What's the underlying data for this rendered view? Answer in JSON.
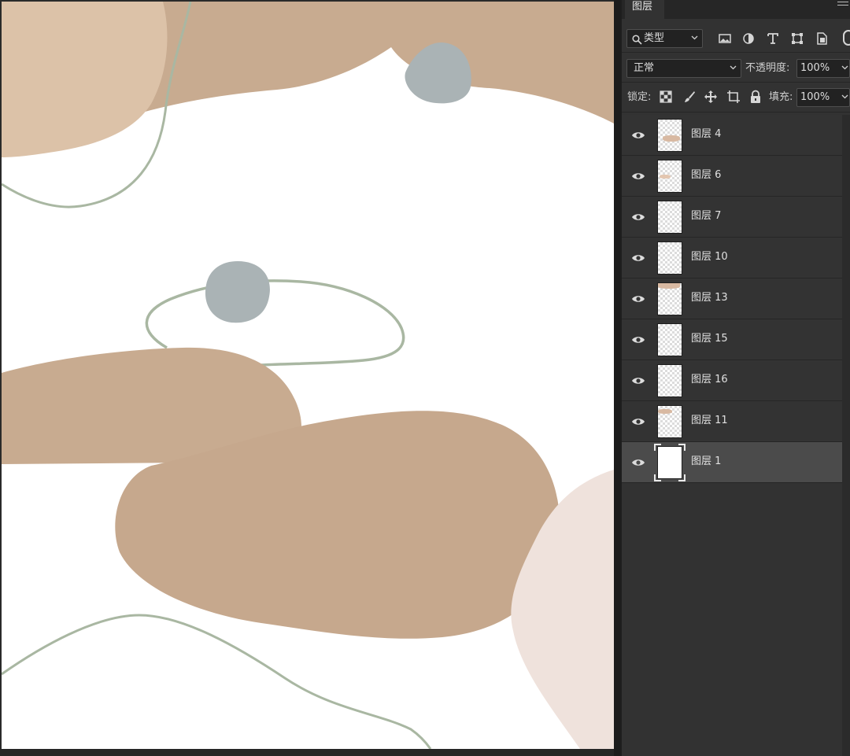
{
  "panel": {
    "tab_label": "图层",
    "filter": {
      "value": "类型",
      "icons": [
        "image-filter-icon",
        "adjustment-filter-icon",
        "type-filter-icon",
        "shape-filter-icon",
        "smart-object-filter-icon"
      ]
    },
    "blend_mode": "正常",
    "opacity_label": "不透明度:",
    "opacity_value": "100%",
    "lock_label": "锁定:",
    "fill_label": "填充:",
    "fill_value": "100%"
  },
  "layers": [
    {
      "name": "图层 4",
      "visible": true,
      "selected": false
    },
    {
      "name": "图层 6",
      "visible": true,
      "selected": false
    },
    {
      "name": "图层 7",
      "visible": true,
      "selected": false
    },
    {
      "name": "图层 10",
      "visible": true,
      "selected": false
    },
    {
      "name": "图层 13",
      "visible": true,
      "selected": false
    },
    {
      "name": "图层 15",
      "visible": true,
      "selected": false
    },
    {
      "name": "图层 16",
      "visible": true,
      "selected": false
    },
    {
      "name": "图层 11",
      "visible": true,
      "selected": false
    },
    {
      "name": "图层 1",
      "visible": true,
      "selected": true
    }
  ],
  "colors": {
    "beige_shape": "#c7a98f",
    "light_beige_shape": "#ddc2a7",
    "pink_shape": "#efe1dc",
    "grey_stone": "#aab3b5",
    "green_line": "#a9b7a2",
    "panel_bg": "#323232",
    "selected_layer_bg": "#4b4b4b"
  }
}
